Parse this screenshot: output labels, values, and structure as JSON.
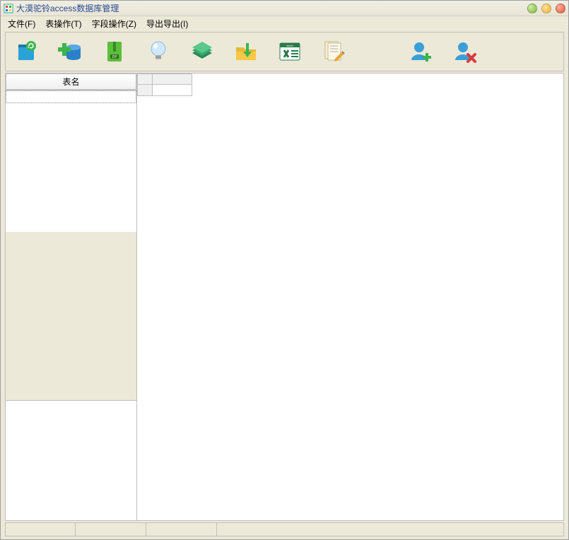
{
  "window": {
    "title": "大漠驼铃access数据库管理"
  },
  "menubar": {
    "items": [
      {
        "label": "文件(F)"
      },
      {
        "label": "表操作(T)"
      },
      {
        "label": "字段操作(Z)"
      },
      {
        "label": "导出导出(I)"
      }
    ]
  },
  "toolbar": {
    "buttons": [
      {
        "icon": "book-refresh-icon"
      },
      {
        "icon": "database-add-icon"
      },
      {
        "icon": "zip-archive-icon"
      },
      {
        "icon": "lightbulb-icon"
      },
      {
        "icon": "books-stack-icon"
      },
      {
        "icon": "folder-download-icon"
      },
      {
        "icon": "excel-export-icon"
      },
      {
        "icon": "document-edit-icon"
      }
    ],
    "user_buttons": [
      {
        "icon": "user-add-icon"
      },
      {
        "icon": "user-delete-icon"
      }
    ]
  },
  "left_panel": {
    "table_list_header": "表名"
  },
  "colors": {
    "minimize": "#7db53a",
    "maximize": "#f3b23a",
    "close": "#e8553b"
  }
}
